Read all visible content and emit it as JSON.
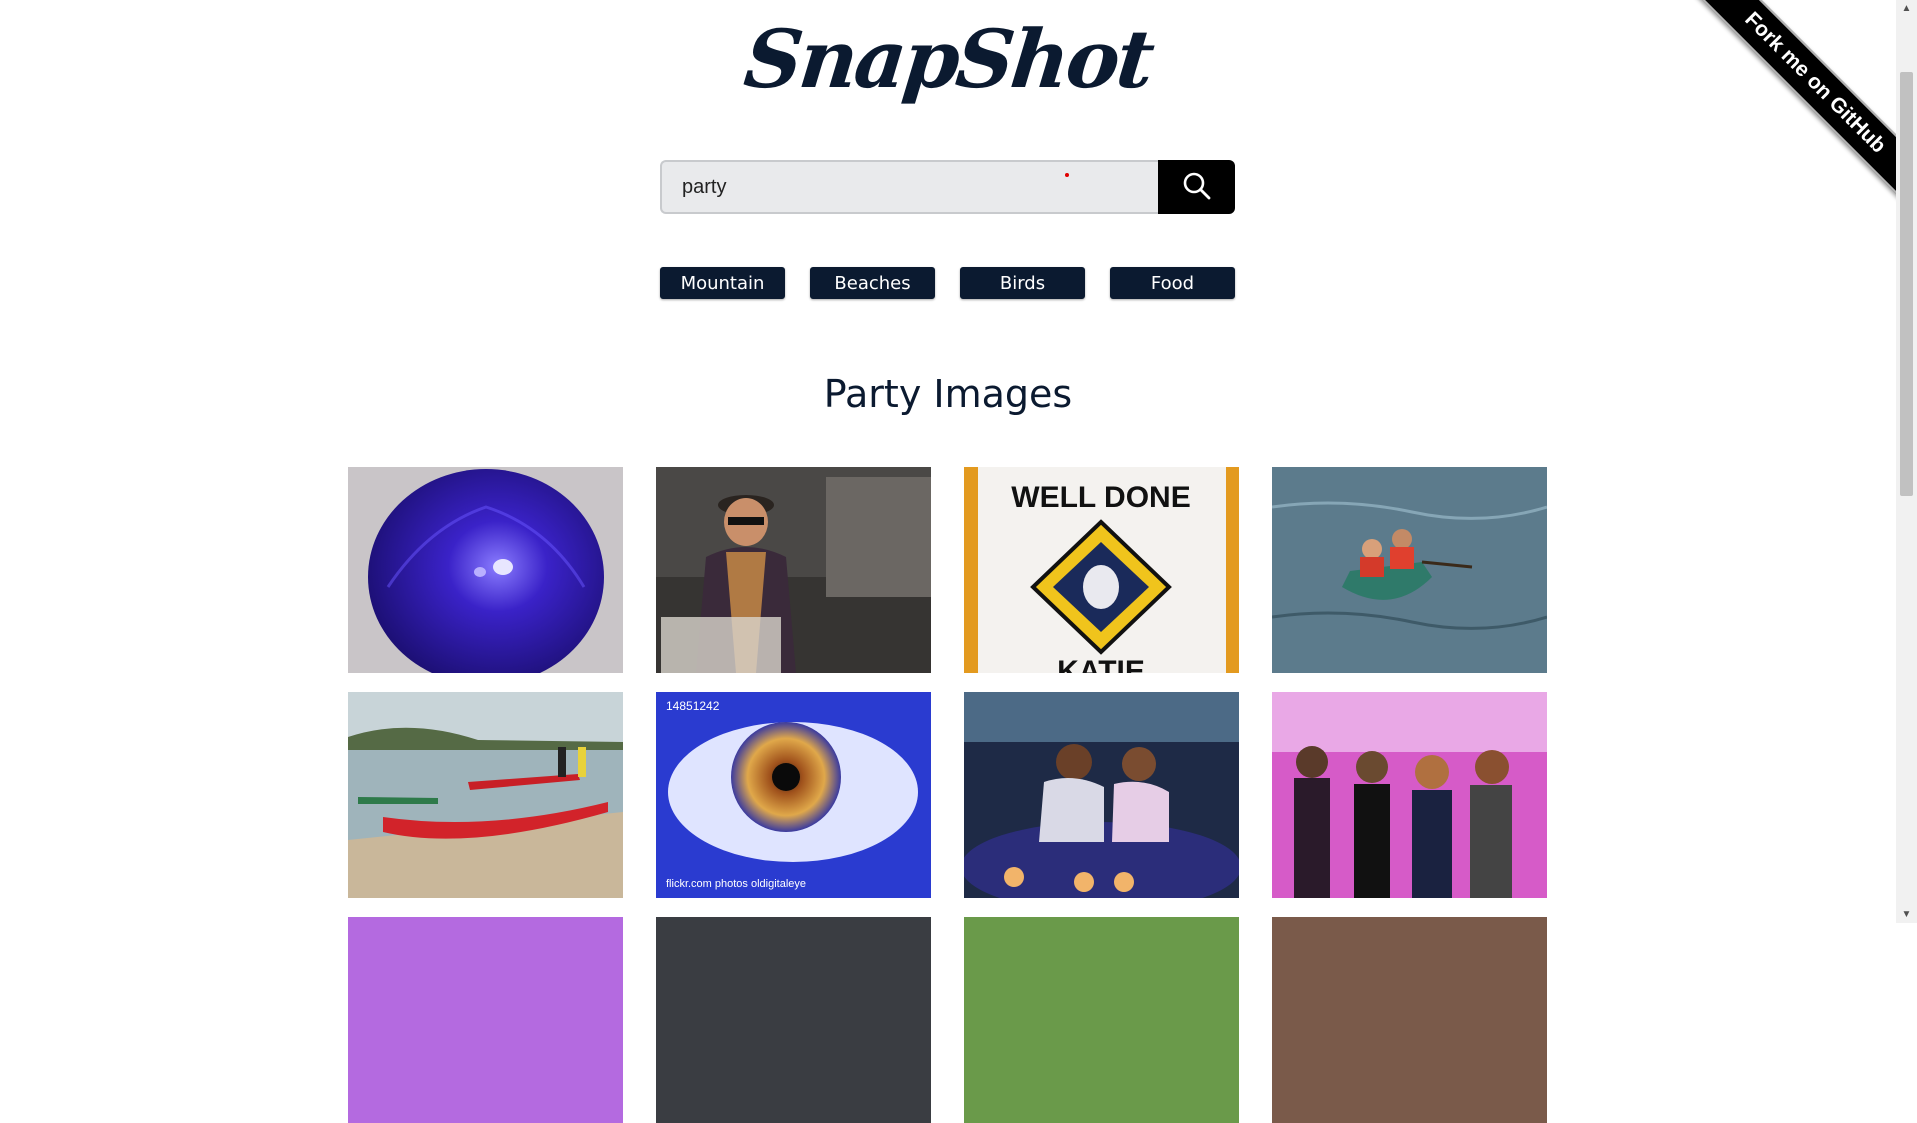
{
  "app": {
    "logo_text": "SnapShot"
  },
  "search": {
    "value": "party",
    "button_icon": "search-icon"
  },
  "categories": [
    "Mountain",
    "Beaches",
    "Birds",
    "Food"
  ],
  "results": {
    "title": "Party Images"
  },
  "gallery": [
    {
      "icon": "purple-balloon-image"
    },
    {
      "icon": "man-with-hat-image"
    },
    {
      "icon": "well-done-cake-image"
    },
    {
      "icon": "canoe-on-lake-image"
    },
    {
      "icon": "kayaks-on-beach-image"
    },
    {
      "icon": "blue-eye-image"
    },
    {
      "icon": "bumper-car-image"
    },
    {
      "icon": "dancing-party-image"
    }
  ],
  "ribbon": {
    "label": "Fork me on GitHub"
  },
  "colors": {
    "navy": "#0b1a30",
    "search_bg": "#e9eaec",
    "black": "#000000"
  }
}
